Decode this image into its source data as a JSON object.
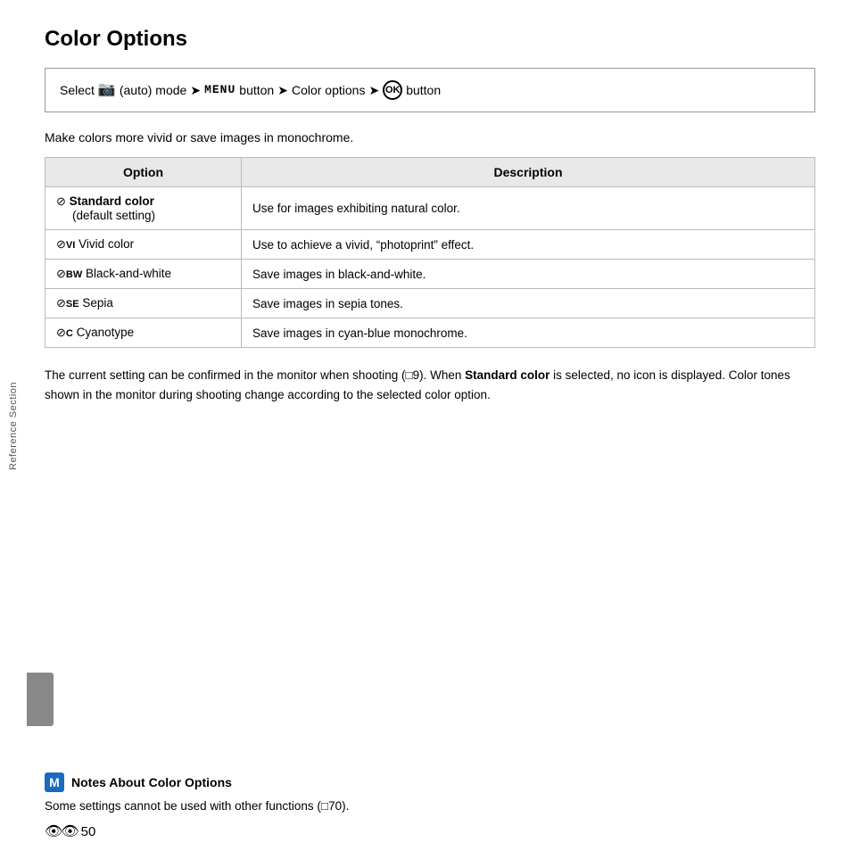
{
  "page": {
    "title": "Color Options",
    "instruction": {
      "prefix": "Select",
      "camera_icon": "📷",
      "auto_mode": "(auto) mode",
      "arrow1": "➜",
      "menu_label": "MENU",
      "button1": "button",
      "arrow2": "➜",
      "color_options": "Color options",
      "arrow3": "➜",
      "ok_label": "OK",
      "button2": "button"
    },
    "intro_text": "Make colors more vivid or save images in monochrome.",
    "table": {
      "headers": [
        "Option",
        "Description"
      ],
      "rows": [
        {
          "icon": "⊘",
          "option": "Standard color\n(default setting)",
          "description": "Use for images exhibiting natural color."
        },
        {
          "icon": "⊘VI",
          "option": "Vivid color",
          "description": "Use to achieve a vivid, “photoprint” effect."
        },
        {
          "icon": "⊘BW",
          "option": "Black-and-white",
          "description": "Save images in black-and-white."
        },
        {
          "icon": "⊘SE",
          "option": "Sepia",
          "description": "Save images in sepia tones."
        },
        {
          "icon": "⊘C",
          "option": "Cyanotype",
          "description": "Save images in cyan-blue monochrome."
        }
      ]
    },
    "body_text": "The current setting can be confirmed in the monitor when shooting (□9). When Standard color is selected, no icon is displayed. Color tones shown in the monitor during shooting change according to the selected color option.",
    "body_text_bold1": "Standard",
    "body_text_bold2": "color",
    "notes": {
      "icon_label": "M",
      "header": "Notes About Color Options",
      "text": "Some settings cannot be used with other functions (□70)."
    },
    "side_label": "Reference Section",
    "page_number": "50",
    "binoculars": "🔭"
  }
}
